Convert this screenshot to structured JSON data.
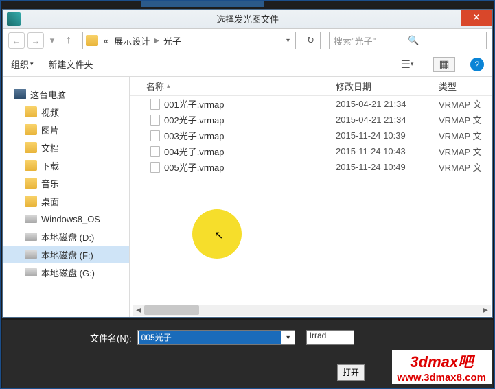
{
  "title": "选择发光图文件",
  "breadcrumb": {
    "prefix": "«",
    "p1": "展示设计",
    "p2": "光子"
  },
  "search": {
    "placeholder": "搜索\"光子\""
  },
  "toolbar": {
    "organize": "组织",
    "newfolder": "新建文件夹"
  },
  "sidebar": {
    "pc": "这台电脑",
    "items": [
      "视频",
      "图片",
      "文档",
      "下载",
      "音乐",
      "桌面",
      "Windows8_OS",
      "本地磁盘 (D:)",
      "本地磁盘 (F:)",
      "本地磁盘 (G:)"
    ]
  },
  "columns": {
    "name": "名称",
    "date": "修改日期",
    "type": "类型"
  },
  "files": [
    {
      "name": "001光子.vrmap",
      "date": "2015-04-21 21:34",
      "type": "VRMAP 文"
    },
    {
      "name": "002光子.vrmap",
      "date": "2015-04-21 21:34",
      "type": "VRMAP 文"
    },
    {
      "name": "003光子.vrmap",
      "date": "2015-11-24 10:39",
      "type": "VRMAP 文"
    },
    {
      "name": "004光子.vrmap",
      "date": "2015-11-24 10:43",
      "type": "VRMAP 文"
    },
    {
      "name": "005光子.vrmap",
      "date": "2015-11-24 10:49",
      "type": "VRMAP 文"
    }
  ],
  "filename": {
    "label": "文件名(N):",
    "value": "005光子"
  },
  "filter": "Irrad",
  "open": "打开",
  "watermark": {
    "l1": "3dmax吧",
    "l2": "www.3dmax8.com"
  }
}
